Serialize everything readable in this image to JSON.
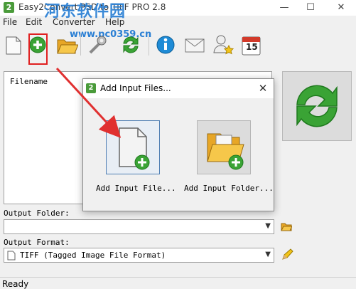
{
  "window": {
    "title": "Easy2Convert PSD to TIFF PRO 2.8",
    "app_icon_text": "2",
    "minimize": "—",
    "maximize": "☐",
    "close": "✕"
  },
  "watermark": {
    "text": "河东软件园",
    "url": "www.pc0359.cn"
  },
  "menu": [
    "File",
    "Edit",
    "Converter",
    "Help"
  ],
  "toolbar": {
    "icons": [
      "new-icon",
      "add-files-icon",
      "open-folder-icon",
      "settings-icon",
      "convert-icon",
      "info-icon",
      "mail-icon",
      "favorite-user-icon",
      "calendar-icon"
    ],
    "calendar_day": "15"
  },
  "file_list": {
    "header": "Filename"
  },
  "output_folder": {
    "label": "Output Folder:",
    "value": ""
  },
  "output_format": {
    "label": "Output Format:",
    "value": "TIFF (Tagged Image File Format)"
  },
  "status": "Ready",
  "dialog": {
    "title": "Add Input Files...",
    "icon_text": "2",
    "close": "✕",
    "add_file_label": "Add Input File...",
    "add_folder_label": "Add Input Folder..."
  },
  "colors": {
    "accent_green": "#3aa335",
    "highlight_red": "#e02020",
    "arrow_red": "#e03030",
    "watermark_blue": "#2a7fd4"
  }
}
